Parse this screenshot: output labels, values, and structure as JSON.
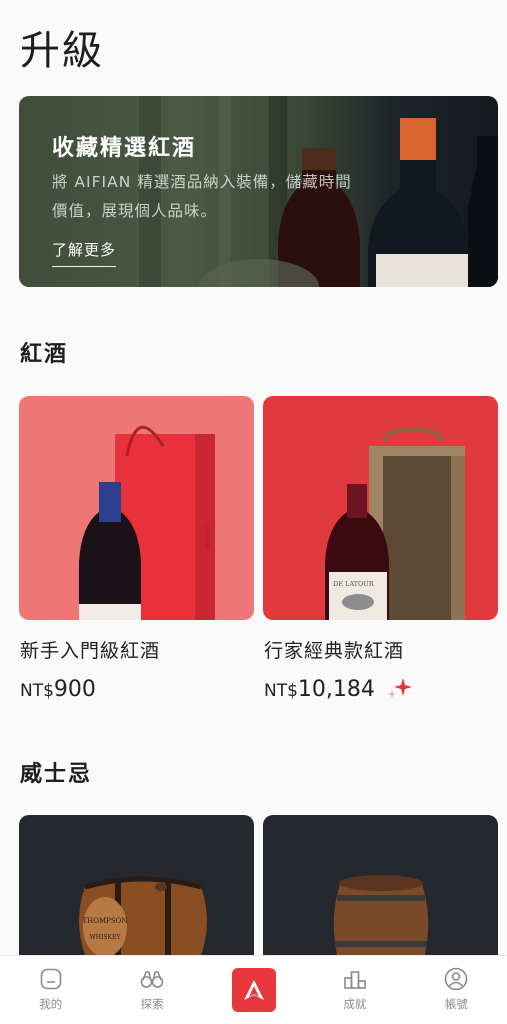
{
  "page": {
    "title": "升級"
  },
  "hero": {
    "title": "收藏精選紅酒",
    "description": "將 AIFIAN 精選酒品納入裝備，儲藏時間價值，展現個人品味。",
    "link_label": "了解更多"
  },
  "sections": [
    {
      "title": "紅酒",
      "items": [
        {
          "name": "新手入門級紅酒",
          "currency": "NT$",
          "price": "900",
          "bg_color": "#ef7676"
        },
        {
          "name": "行家經典款紅酒",
          "currency": "NT$",
          "price": "10,184",
          "bg_color": "#e0393e",
          "sparkle_icon": "sparkle-icon"
        }
      ]
    },
    {
      "title": "威士忌",
      "items": [
        {
          "bg_color": "#25282e"
        },
        {
          "bg_color": "#25282e"
        }
      ]
    }
  ],
  "wine_labels": {
    "box_brand": "AIFIAN",
    "bottle_label": "DE LATOUR"
  },
  "barrel_label": {
    "brand": "THOMPSON",
    "sub": "WHISKEY"
  },
  "tabbar": {
    "items": [
      {
        "label": "我的",
        "icon": "profile-card-icon"
      },
      {
        "label": "探索",
        "icon": "binoculars-icon"
      },
      {
        "label": "",
        "icon": "aifian-logo-icon"
      },
      {
        "label": "成就",
        "icon": "podium-icon"
      },
      {
        "label": "帳號",
        "icon": "account-icon"
      }
    ]
  },
  "colors": {
    "accent": "#e8383d",
    "background": "#fafafa",
    "text": "#1e1e1e"
  }
}
